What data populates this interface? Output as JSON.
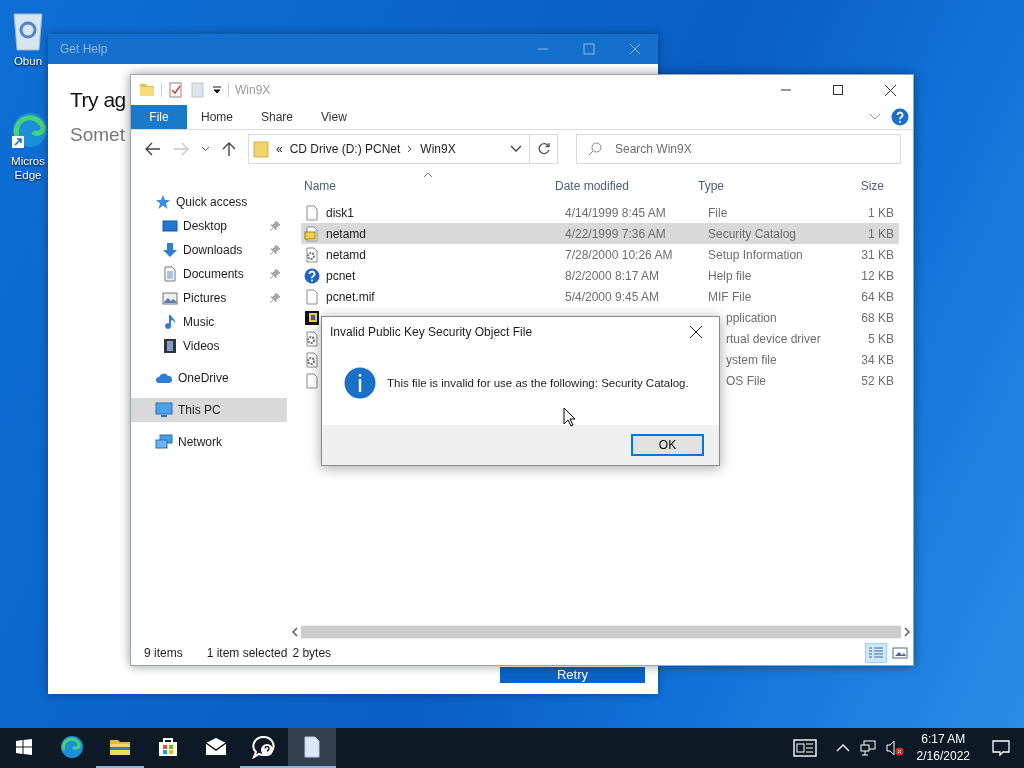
{
  "desktop_icons": [
    {
      "kind": "recycle-bin",
      "label": "Obun"
    },
    {
      "kind": "edge",
      "label": "Micros Edge"
    }
  ],
  "get_help": {
    "title": "Get Help",
    "heading": "Try ag",
    "subheading": "Somet",
    "button": "Retry"
  },
  "explorer": {
    "title": "Win9X",
    "ribbon_tabs": [
      {
        "label": "File",
        "selected": true
      },
      {
        "label": "Home",
        "selected": false
      },
      {
        "label": "Share",
        "selected": false
      },
      {
        "label": "View",
        "selected": false
      }
    ],
    "address": {
      "overflow": "«",
      "crumbs": [
        "CD Drive (D:) PCNet",
        "Win9X"
      ]
    },
    "search": {
      "placeholder": "Search Win9X"
    },
    "nav": [
      {
        "label": "Quick access",
        "kind": "star",
        "selected": false,
        "children": [
          {
            "label": "Desktop",
            "kind": "desktop",
            "pinned": true,
            "selected": false
          },
          {
            "label": "Downloads",
            "kind": "downloads",
            "pinned": true,
            "selected": false
          },
          {
            "label": "Documents",
            "kind": "documents",
            "pinned": true,
            "selected": false
          },
          {
            "label": "Pictures",
            "kind": "pictures",
            "pinned": true,
            "selected": false
          },
          {
            "label": "Music",
            "kind": "music",
            "pinned": false,
            "selected": false
          },
          {
            "label": "Videos",
            "kind": "videos",
            "pinned": false,
            "selected": false
          }
        ]
      },
      {
        "label": "OneDrive",
        "kind": "cloud",
        "selected": false
      },
      {
        "label": "This PC",
        "kind": "pc",
        "selected": true
      },
      {
        "label": "Network",
        "kind": "network",
        "selected": false
      }
    ],
    "columns": [
      "Name",
      "Date modified",
      "Type",
      "Size"
    ],
    "files": [
      {
        "kind": "blank",
        "name": "disk1",
        "date": "4/14/1999 8:45 AM",
        "type": "File",
        "size": "1 KB",
        "selected": false
      },
      {
        "kind": "catalog",
        "name": "netamd",
        "date": "4/22/1999 7:36 AM",
        "type": "Security Catalog",
        "size": "1 KB",
        "selected": true
      },
      {
        "kind": "setup",
        "name": "netamd",
        "date": "7/28/2000 10:26 AM",
        "type": "Setup Information",
        "size": "31 KB",
        "selected": false
      },
      {
        "kind": "help",
        "name": "pcnet",
        "date": "8/2/2000 8:17 AM",
        "type": "Help file",
        "size": "12 KB",
        "selected": false
      },
      {
        "kind": "blank",
        "name": "pcnet.mif",
        "date": "5/4/2000 9:45 AM",
        "type": "MIF File",
        "size": "64 KB",
        "selected": false
      },
      {
        "kind": "exe",
        "type": "pplication",
        "size": "68 KB",
        "selected": false
      },
      {
        "kind": "setup",
        "type": "rtual device driver",
        "size": "5 KB",
        "selected": false
      },
      {
        "kind": "setup",
        "type": "ystem file",
        "size": "34 KB",
        "selected": false
      },
      {
        "kind": "blank",
        "type": "OS File",
        "size": "52 KB",
        "selected": false
      }
    ],
    "status": {
      "count": "9 items",
      "selection": "1 item selected",
      "size": "2 bytes"
    },
    "views": [
      {
        "kind": "details",
        "selected": true
      },
      {
        "kind": "thumbnails",
        "selected": false
      }
    ]
  },
  "dialog": {
    "title": "Invalid Public Key Security Object File",
    "message": "This file is invalid for use as the following: Security Catalog.",
    "button": "OK"
  },
  "taskbar": {
    "apps": [
      {
        "kind": "edge",
        "running": false,
        "active": false
      },
      {
        "kind": "explorer",
        "running": true,
        "active": false
      },
      {
        "kind": "store",
        "running": false,
        "active": false
      },
      {
        "kind": "mail",
        "running": false,
        "active": false
      },
      {
        "kind": "help",
        "running": true,
        "active": false
      },
      {
        "kind": "document",
        "running": true,
        "active": true
      }
    ],
    "time": "6:17 AM",
    "date": "2/16/2022"
  }
}
